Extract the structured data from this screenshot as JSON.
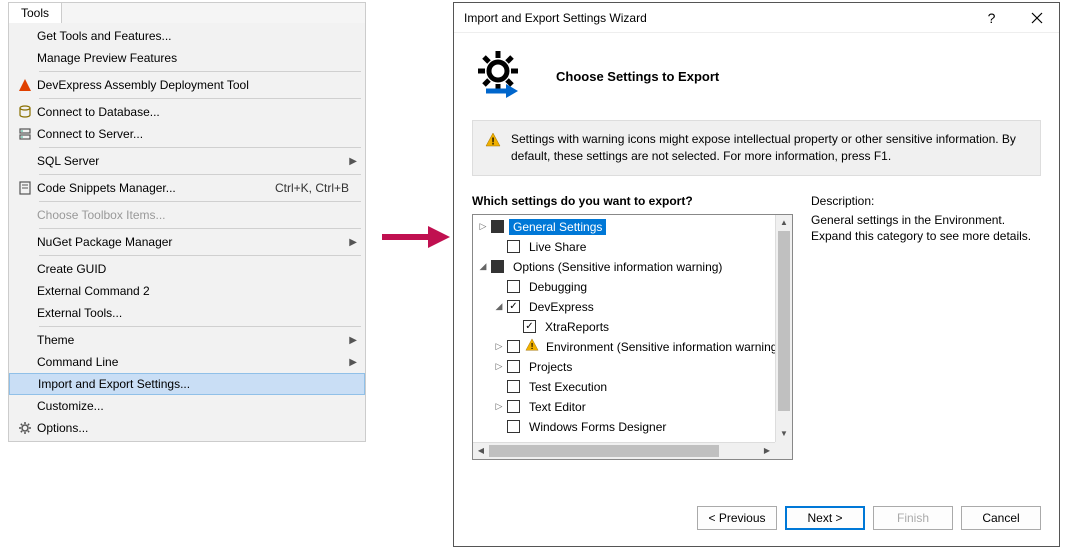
{
  "tools_menu": {
    "tab": "Tools",
    "items": [
      {
        "label": "Get Tools and Features...",
        "icon": null
      },
      {
        "label": "Manage Preview Features",
        "icon": null
      },
      {
        "sep": true
      },
      {
        "label": "DevExpress Assembly Deployment Tool",
        "icon": "devexpress-icon"
      },
      {
        "sep": true
      },
      {
        "label": "Connect to Database...",
        "icon": "database-icon"
      },
      {
        "label": "Connect to Server...",
        "icon": "server-icon"
      },
      {
        "sep": true
      },
      {
        "label": "SQL Server",
        "submenu": true
      },
      {
        "sep": true
      },
      {
        "label": "Code Snippets Manager...",
        "icon": "snippets-icon",
        "shortcut": "Ctrl+K, Ctrl+B"
      },
      {
        "sep": true
      },
      {
        "label": "Choose Toolbox Items...",
        "disabled": true
      },
      {
        "sep": true
      },
      {
        "label": "NuGet Package Manager",
        "submenu": true
      },
      {
        "sep": true
      },
      {
        "label": "Create GUID"
      },
      {
        "label": "External Command 2"
      },
      {
        "label": "External Tools..."
      },
      {
        "sep": true
      },
      {
        "label": "Theme",
        "submenu": true
      },
      {
        "label": "Command Line",
        "submenu": true
      },
      {
        "label": "Import and Export Settings...",
        "highlighted": true
      },
      {
        "label": "Customize..."
      },
      {
        "label": "Options...",
        "icon": "gear-icon"
      }
    ]
  },
  "dialog": {
    "title": "Import and Export Settings Wizard",
    "header": "Choose Settings to Export",
    "warning": "Settings with warning icons might expose intellectual property or other sensitive information. By default, these settings are not selected. For more information, press F1.",
    "prompt": "Which settings do you want to export?",
    "tree": [
      {
        "level": 1,
        "expander": "▷",
        "check": "filled",
        "label": "General Settings",
        "selected": true
      },
      {
        "level": 2,
        "expander": "",
        "check": "empty",
        "label": "Live Share"
      },
      {
        "level": 1,
        "expander": "◢",
        "check": "filled",
        "label": "Options (Sensitive information warning)"
      },
      {
        "level": 2,
        "expander": "",
        "check": "empty",
        "label": "Debugging"
      },
      {
        "level": 2,
        "expander": "◢",
        "check": "checked",
        "label": "DevExpress"
      },
      {
        "level": 3,
        "expander": "",
        "check": "checked",
        "label": "XtraReports"
      },
      {
        "level": 2,
        "expander": "▷",
        "check": "empty",
        "label": "Environment (Sensitive information warning)",
        "warn": true
      },
      {
        "level": 2,
        "expander": "▷",
        "check": "empty",
        "label": "Projects"
      },
      {
        "level": 2,
        "expander": "",
        "check": "empty",
        "label": "Test Execution"
      },
      {
        "level": 2,
        "expander": "▷",
        "check": "empty",
        "label": "Text Editor"
      },
      {
        "level": 2,
        "expander": "",
        "check": "empty",
        "label": "Windows Forms Designer"
      }
    ],
    "description_label": "Description:",
    "description_text": "General settings in the Environment. Expand this category to see more details.",
    "buttons": {
      "previous": "< Previous",
      "next": "Next >",
      "finish": "Finish",
      "cancel": "Cancel"
    }
  }
}
